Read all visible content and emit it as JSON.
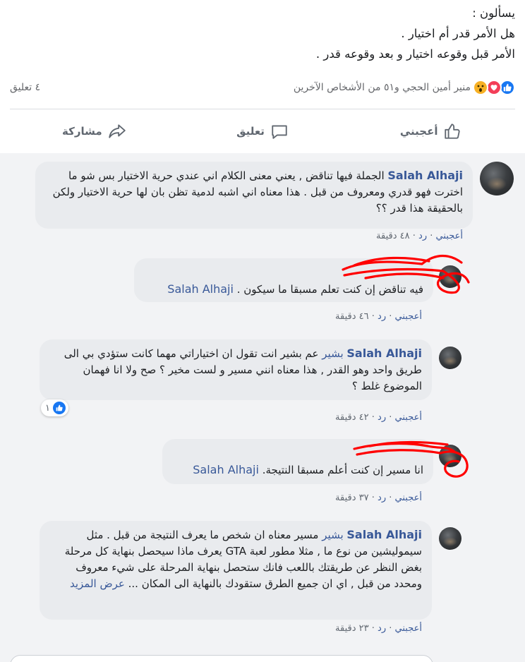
{
  "post": {
    "lines": [
      "يسألون :",
      "هل الأمر قدر أم اختيار .",
      "الأمر قبل وقوعه اختيار و بعد وقوعه قدر ."
    ]
  },
  "reactions": {
    "icons": [
      "like-icon",
      "love-icon",
      "wow-icon"
    ],
    "summary": "منير أمين الحجي و٥١ من الأشخاص الآخرين",
    "comment_count": "٤ تعليق"
  },
  "actions": {
    "like": "أعجبني",
    "comment": "تعليق",
    "share": "مشاركة"
  },
  "colors": {
    "link": "#385898",
    "like_blue": "#1877f2",
    "bubble": "#e9ebee",
    "scribble": "#ff0000"
  },
  "comments": [
    {
      "author": "Salah Alhaji",
      "text": "الجملة فيها تناقض , يعني معنى الكلام اني عندي حرية الاختيار بس شو ما اخترت فهو قدري ومعروف من قبل . هذا معناه اني اشبه لدمية تظن بان لها حرية الاختيار ولكن بالحقيقة هذا قدر ؟؟",
      "like": "أعجبني",
      "reply": "رد",
      "time": "٤٨ دقيقة",
      "sep": "·"
    },
    {
      "mention": "Salah Alhaji",
      "text": "فيه تناقض إن كنت تعلم مسبقا ما سيكون .",
      "like": "أعجبني",
      "reply": "رد",
      "time": "٤٦ دقيقة",
      "sep": "·"
    },
    {
      "author": "Salah Alhaji",
      "mention": "بشير",
      "text": "عم بشير انت تقول ان اختياراتي مهما كانت ستؤدي بي الى طريق واحد وهو القدر , هذا معناه انني مسير و لست مخير ؟ صح ولا انا فهمان الموضوع غلط ؟",
      "reaction_count": "١",
      "like": "أعجبني",
      "reply": "رد",
      "time": "٤٢ دقيقة",
      "sep": "·"
    },
    {
      "mention": "Salah Alhaji",
      "text": "انا مسير إن كنت أعلم مسبقا النتيجة.",
      "like": "أعجبني",
      "reply": "رد",
      "time": "٣٧ دقيقة",
      "sep": "·"
    },
    {
      "author": "Salah Alhaji",
      "mention": "بشير",
      "text": "مسير معناه ان شخص ما يعرف النتيجة من قبل . مثل سيموليشين من نوع ما , مثلا مطور لعبة GTA يعرف ماذا سيحصل بنهاية كل مرحلة بغض النظر عن طريقتك باللعب فانك ستحصل بنهاية المرحلة على شيء معروف ومحدد من قبل , اي ان جميع الطرق ستقودك بالنهاية الى المكان ...",
      "see_more": "عرض المزيد",
      "like": "أعجبني",
      "reply": "رد",
      "time": "٢٣ دقيقة",
      "sep": "·"
    }
  ]
}
